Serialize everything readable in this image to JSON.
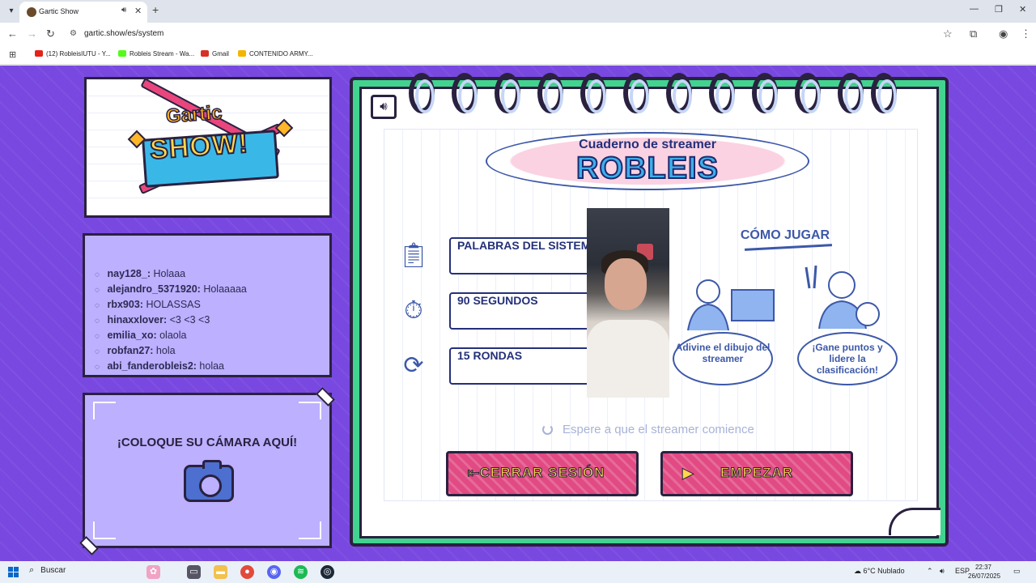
{
  "browser": {
    "tab_title": "Gartic Show",
    "url": "gartic.show/es/system",
    "bookmarks": [
      {
        "label": "(12) RobleisIUTU - Y...",
        "color": "#e62117"
      },
      {
        "label": "Robleis Stream - Wa...",
        "color": "#53fc18"
      },
      {
        "label": "Gmail",
        "color": "#d93025"
      },
      {
        "label": "CONTENIDO ARMY...",
        "color": "#f4b400"
      }
    ]
  },
  "logo": {
    "top_word": "Gartic",
    "main_word": "SHOW!"
  },
  "chat": {
    "messages": [
      {
        "user": "nay128_:",
        "text": "Holaaa"
      },
      {
        "user": "alejandro_5371920:",
        "text": "Holaaaaa"
      },
      {
        "user": "rbx903:",
        "text": "HOLASSAS"
      },
      {
        "user": "hinaxxlover:",
        "text": "<3 <3 <3"
      },
      {
        "user": "emilia_xo:",
        "text": "olaola"
      },
      {
        "user": "robfan27:",
        "text": "hola"
      },
      {
        "user": "abi_fanderobleis2:",
        "text": "holaa"
      }
    ]
  },
  "camera": {
    "title": "¡COLOQUE SU CÁMARA AQUÍ!"
  },
  "notebook": {
    "subtitle": "Cuaderno de streamer",
    "streamer_name": "ROBLEIS",
    "options": [
      {
        "label": "PALABRAS DEL SISTEMA",
        "icon": "notebook-icon"
      },
      {
        "label": "90 SEGUNDOS",
        "icon": "stopwatch-icon"
      },
      {
        "label": "15 RONDAS",
        "icon": "rounds-icon"
      }
    ],
    "howto": {
      "title": "CÓMO JUGAR",
      "step1": "Adivine el dibujo del streamer",
      "step2": "¡Gane puntos y lidere la clasificación!"
    },
    "status": "Espere a que el streamer comience",
    "logout_label": "CERRAR SESIÓN",
    "start_label": "EMPEZAR"
  },
  "taskbar": {
    "search_label": "Buscar",
    "weather": "6°C  Nublado",
    "lang": "ESP",
    "time": "22:37",
    "date": "26/07/2025"
  },
  "colors": {
    "background_purple": "#7848e0",
    "notebook_green": "#42d38f",
    "button_pink": "#e14a83",
    "button_text_yellow": "#ffd84a",
    "ink_blue": "#24307a"
  }
}
